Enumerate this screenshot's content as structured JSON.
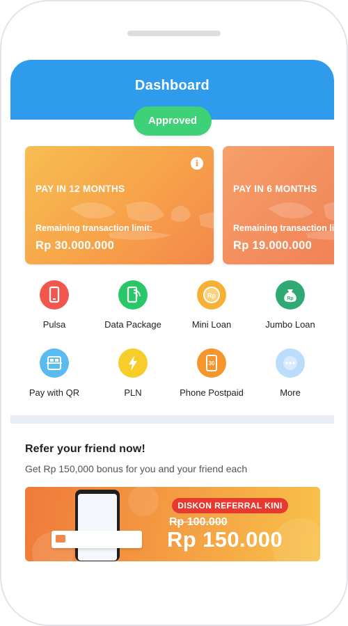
{
  "header": {
    "title": "Dashboard"
  },
  "status": {
    "label": "Approved"
  },
  "limits": [
    {
      "title": "PAY IN 12 MONTHS",
      "subtitle": "Remaining transaction limit:",
      "amount": "Rp 30.000.000"
    },
    {
      "title": "PAY IN 6 MONTHS",
      "subtitle": "Remaining transaction limit:",
      "amount": "Rp 19.000.000"
    }
  ],
  "services": [
    {
      "label": "Pulsa",
      "icon": "phone-icon",
      "color": "#f2574e"
    },
    {
      "label": "Data Package",
      "icon": "data-phone-icon",
      "color": "#28c768"
    },
    {
      "label": "Mini Loan",
      "icon": "rp-coin-icon",
      "color": "#f6b134"
    },
    {
      "label": "Jumbo Loan",
      "icon": "money-bag-icon",
      "color": "#2faa73"
    },
    {
      "label": "Pay with QR",
      "icon": "qr-scan-icon",
      "color": "#59bbf0"
    },
    {
      "label": "PLN",
      "icon": "lightning-icon",
      "color": "#f7cd2a"
    },
    {
      "label": "Phone Postpaid",
      "icon": "phone-30-icon",
      "color": "#f4962c"
    },
    {
      "label": "More",
      "icon": "more-dots-icon",
      "color": "#b9ddfb"
    }
  ],
  "refer": {
    "title": "Refer your friend now!",
    "subtitle": "Get Rp 150,000 bonus for you and your friend each",
    "banner": {
      "tag": "DISKON REFERRAL KINI",
      "old_price": "Rp 100.000",
      "new_price": "Rp 150.000"
    }
  },
  "colors": {
    "header": "#2e9bed",
    "approved": "#3fd178",
    "band": "#e8eef7"
  }
}
